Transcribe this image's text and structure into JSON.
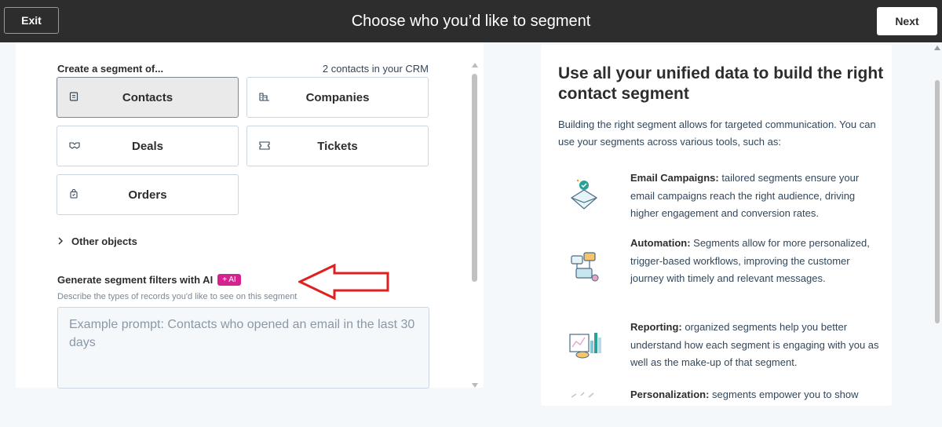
{
  "header": {
    "exit_label": "Exit",
    "title": "Choose who you’d like to segment",
    "next_label": "Next"
  },
  "segment": {
    "label": "Create a segment of...",
    "crm_count": "2 contacts in your CRM",
    "objects": [
      {
        "label": "Contacts",
        "icon": "contact-card-icon",
        "selected": true
      },
      {
        "label": "Companies",
        "icon": "building-icon",
        "selected": false
      },
      {
        "label": "Deals",
        "icon": "handshake-icon",
        "selected": false
      },
      {
        "label": "Tickets",
        "icon": "ticket-icon",
        "selected": false
      },
      {
        "label": "Orders",
        "icon": "shopping-bag-icon",
        "selected": false
      }
    ],
    "other_objects": "Other objects"
  },
  "ai": {
    "title": "Generate segment filters with AI",
    "badge": "+ AI",
    "description": "Describe the types of records you'd like to see on this segment",
    "placeholder": "Example prompt: Contacts who opened an email in the last 30 days"
  },
  "info": {
    "title": "Use all your unified data to build the right contact segment",
    "intro": "Building the right segment allows for targeted communication. You can use your segments across various tools, such as:",
    "features": [
      {
        "title": "Email Campaigns:",
        "text": " tailored segments ensure your email campaigns reach the right audience, driving higher engagement and conversion rates.",
        "icon": "email-campaign-icon"
      },
      {
        "title": "Automation:",
        "text": " Segments allow for more personalized, trigger-based workflows, improving the customer journey with timely and relevant messages.",
        "icon": "automation-icon"
      },
      {
        "title": "Reporting:",
        "text": " organized segments help you better understand how each segment is engaging with you as well as the make-up of that segment.",
        "icon": "reporting-chart-icon"
      },
      {
        "title": "Personalization:",
        "text": " segments empower you to show",
        "icon": "personalization-icon"
      }
    ]
  },
  "colors": {
    "header_bg": "#2d2d2d",
    "ai_badge": "#d6228f",
    "annotation_arrow": "#e02020"
  }
}
